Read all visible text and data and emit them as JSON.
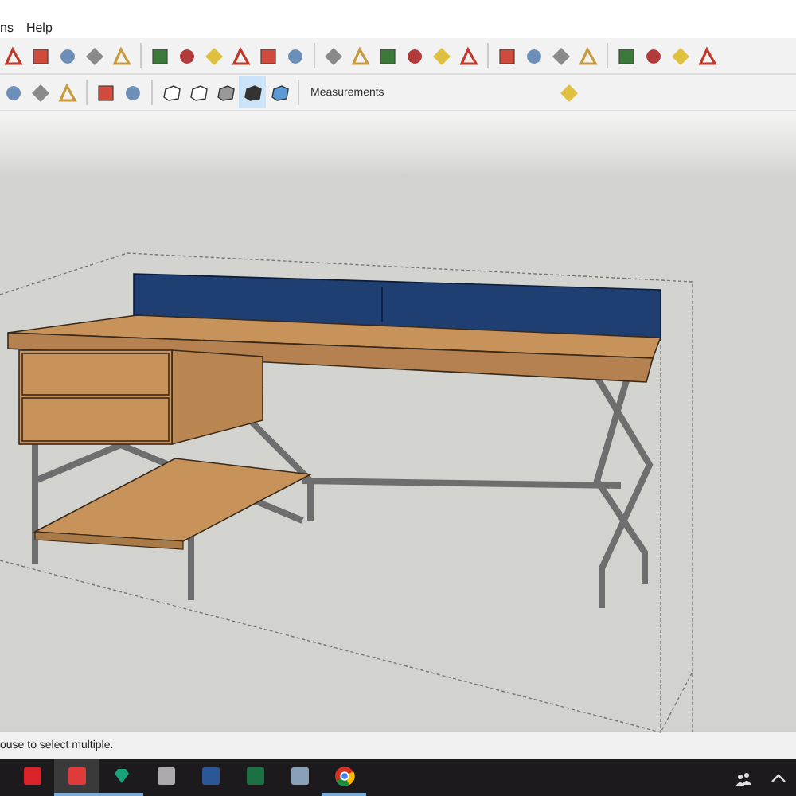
{
  "menu": [
    "ns",
    "Help"
  ],
  "style_buttons": [
    {
      "selected": false
    },
    {
      "selected": false
    },
    {
      "selected": false
    },
    {
      "selected": true
    },
    {
      "selected": false
    }
  ],
  "measurements": {
    "label": "Measurements"
  },
  "status_bar": "ouse to select multiple.",
  "taskbar": {
    "apps": [
      {
        "kind": "autocad",
        "running": false,
        "selected": false
      },
      {
        "kind": "sketchup",
        "running": true,
        "selected": true
      },
      {
        "kind": "gem",
        "running": true,
        "selected": false
      },
      {
        "kind": "layout",
        "running": false,
        "selected": false
      },
      {
        "kind": "word",
        "running": false,
        "selected": false
      },
      {
        "kind": "excel",
        "running": false,
        "selected": false
      },
      {
        "kind": "calculator",
        "running": false,
        "selected": false
      },
      {
        "kind": "chrome",
        "running": true,
        "selected": false
      }
    ]
  }
}
